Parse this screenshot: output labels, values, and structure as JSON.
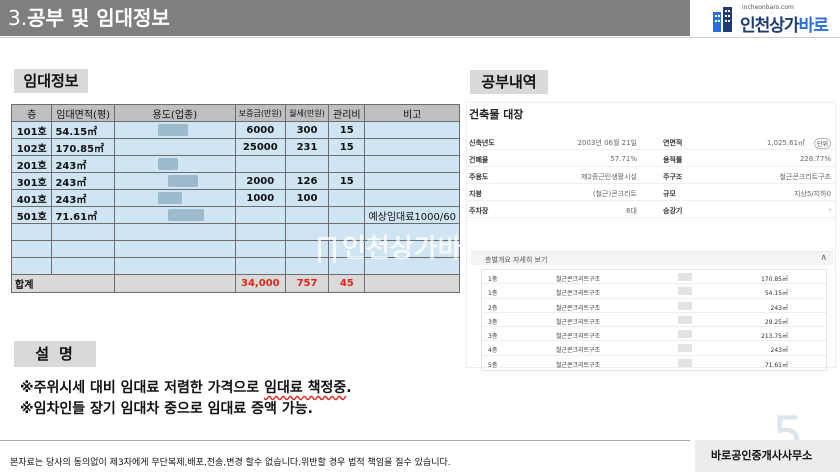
{
  "header": {
    "section_number": "3.",
    "title": "공부 및 임대정보",
    "logo_url": "incheonbaro.com",
    "logo_main": "인천상가",
    "logo_accent": "바로"
  },
  "rental": {
    "label": "임대정보",
    "columns": [
      "층",
      "임대면적(평)",
      "용도(업종)",
      "보증금(만원)",
      "월세(만원)",
      "관리비",
      "비고"
    ],
    "rows": [
      {
        "floor": "101호",
        "area": "54.15㎡",
        "use": "",
        "deposit": "6000",
        "monthly": "300",
        "mgmt": "15",
        "note": ""
      },
      {
        "floor": "102호",
        "area": "170.85㎡",
        "use": "",
        "deposit": "25000",
        "monthly": "231",
        "mgmt": "15",
        "note": ""
      },
      {
        "floor": "201호",
        "area": "243㎡",
        "use": "",
        "deposit": "",
        "monthly": "",
        "mgmt": "",
        "note": ""
      },
      {
        "floor": "301호",
        "area": "243㎡",
        "use": "",
        "deposit": "2000",
        "monthly": "126",
        "mgmt": "15",
        "note": ""
      },
      {
        "floor": "401호",
        "area": "243㎡",
        "use": "",
        "deposit": "1000",
        "monthly": "100",
        "mgmt": "",
        "note": ""
      },
      {
        "floor": "501호",
        "area": "71.61㎡",
        "use": "",
        "deposit": "",
        "monthly": "",
        "mgmt": "",
        "note": "예상임대료1000/60"
      },
      {
        "floor": "",
        "area": "",
        "use": "",
        "deposit": "",
        "monthly": "",
        "mgmt": "",
        "note": ""
      },
      {
        "floor": "",
        "area": "",
        "use": "",
        "deposit": "",
        "monthly": "",
        "mgmt": "",
        "note": ""
      },
      {
        "floor": "",
        "area": "",
        "use": "",
        "deposit": "",
        "monthly": "",
        "mgmt": "",
        "note": ""
      }
    ],
    "total": {
      "label": "합계",
      "deposit": "34,000",
      "monthly": "757",
      "mgmt": "45"
    }
  },
  "watermark": "인천상가바로",
  "public_record": {
    "label": "공부내역",
    "doc_title": "건축물 대장",
    "fields": [
      {
        "k1": "신축년도",
        "v1": "2003년 06월 21일",
        "k2": "연면적",
        "v2": "1,025.61㎡",
        "pill": "단위"
      },
      {
        "k1": "건폐율",
        "v1": "57.71%",
        "k2": "용적률",
        "v2": "228.77%",
        "pill": ""
      },
      {
        "k1": "주용도",
        "v1": "제2종근린생활시설",
        "k2": "주구조",
        "v2": "철근콘크리트구조",
        "pill": ""
      },
      {
        "k1": "지붕",
        "v1": "(철근)콘크리트",
        "k2": "규모",
        "v2": "지상5/지하0",
        "pill": ""
      },
      {
        "k1": "주차장",
        "v1": "6대",
        "k2": "승강기",
        "v2": "-",
        "pill": ""
      }
    ],
    "floor_header": "층별개요 자세히 보기",
    "floor_close": "∧",
    "floors": [
      {
        "floor": "1층",
        "structure": "철근콘크리트구조",
        "area": "170.85㎡"
      },
      {
        "floor": "1층",
        "structure": "철근콘크리트구조",
        "area": "54.15㎡"
      },
      {
        "floor": "2층",
        "structure": "철근콘크리트구조",
        "area": "243㎡"
      },
      {
        "floor": "3층",
        "structure": "철근콘크리트구조",
        "area": "29.25㎡"
      },
      {
        "floor": "3층",
        "structure": "철근콘크리트구조",
        "area": "213.75㎡"
      },
      {
        "floor": "4층",
        "structure": "철근콘크리트구조",
        "area": "243㎡"
      },
      {
        "floor": "5층",
        "structure": "철근콘크리트구조",
        "area": "71.61㎡"
      }
    ]
  },
  "description": {
    "label": "설명",
    "line1_prefix": "※주위시세 대비 임대료 저렴한 가격으로 ",
    "line1_emph": "임대료 책정중",
    "line1_suffix": ".",
    "line2": "※임차인들 장기 임대차 중으로 임대료 증액 가능."
  },
  "footer": {
    "note": "본자료는 당사의 동의없이 제3자에게 무단복제,배포,전송,변경 할수 없습니다.위반할 경우 법적 책임을 질수 있습니다.",
    "company": "바로공인중개사사무소",
    "page_number": "5"
  }
}
